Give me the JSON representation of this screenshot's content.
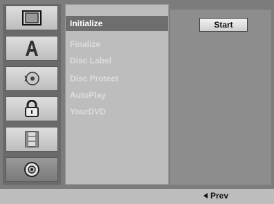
{
  "menu": {
    "items": [
      {
        "label": "Initialize"
      },
      {
        "label": "Finalize"
      },
      {
        "label": "Disc Label"
      },
      {
        "label": "Disc Protect"
      },
      {
        "label": "AutoPlay"
      },
      {
        "label": "YourDVD"
      }
    ]
  },
  "right_panel": {
    "start_label": "Start"
  },
  "footer": {
    "prev_label": "Prev"
  },
  "sidebar": {
    "icons": [
      "tv-icon",
      "language-icon",
      "audio-icon",
      "lock-icon",
      "film-icon",
      "disc-icon"
    ]
  },
  "colors": {
    "selected_bg": "#6e6e6e",
    "panel_bg": "#bdbdbd",
    "disabled_text": "#dcdcdc"
  }
}
